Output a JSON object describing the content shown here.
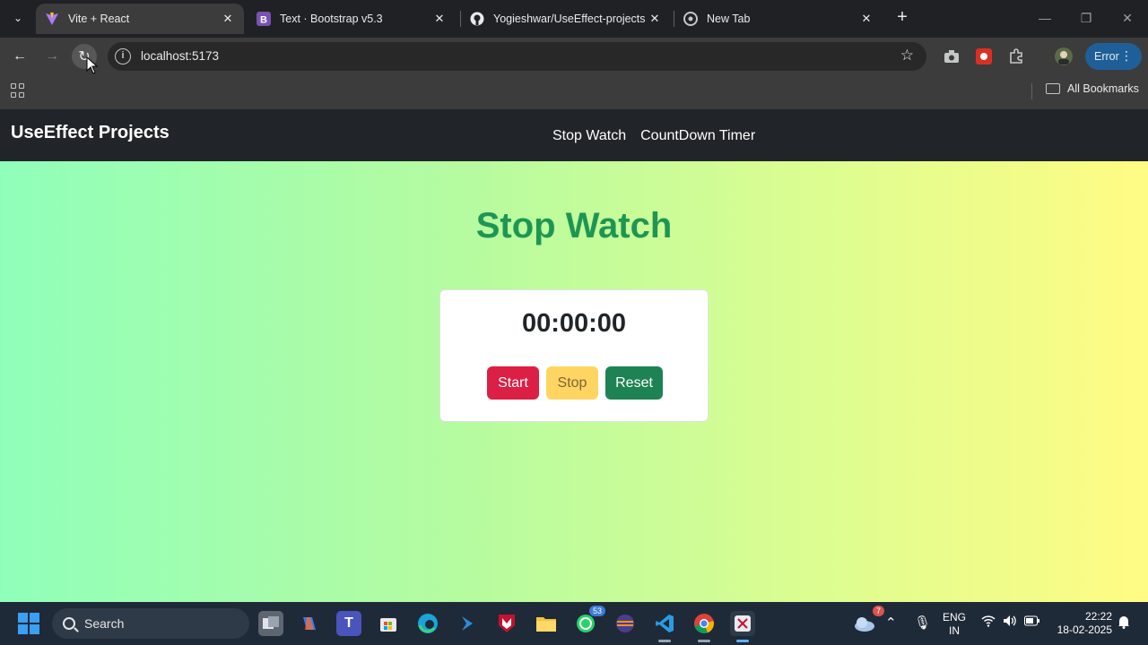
{
  "browser": {
    "tabs": [
      {
        "title": "Vite + React",
        "active": true,
        "favicon": "vite-icon"
      },
      {
        "title": "Text · Bootstrap v5.3",
        "active": false,
        "favicon": "bootstrap-icon"
      },
      {
        "title": "Yogieshwar/UseEffect-projects",
        "active": false,
        "favicon": "github-icon"
      },
      {
        "title": "New Tab",
        "active": false,
        "favicon": "chrome-icon"
      }
    ],
    "address": "localhost:5173",
    "error_label": "Error",
    "bookmarks_label": "All Bookmarks"
  },
  "app": {
    "brand": "UseEffect Projects",
    "nav": [
      {
        "label": "Stop Watch"
      },
      {
        "label": "CountDown Timer"
      }
    ],
    "heading": "Stop Watch",
    "time_display": "00:00:00",
    "buttons": {
      "start": "Start",
      "stop": "Stop",
      "reset": "Reset"
    }
  },
  "colors": {
    "heading": "#1e9653",
    "start": "#dc1f45",
    "stop": "#ffd562",
    "reset": "#1e8354",
    "navbar": "#212529"
  },
  "taskbar": {
    "search_label": "Search",
    "whatsapp_badge": "53",
    "weather_badge": "7",
    "lang_line1": "ENG",
    "lang_line2": "IN",
    "time": "22:22",
    "date": "18-02-2025"
  }
}
